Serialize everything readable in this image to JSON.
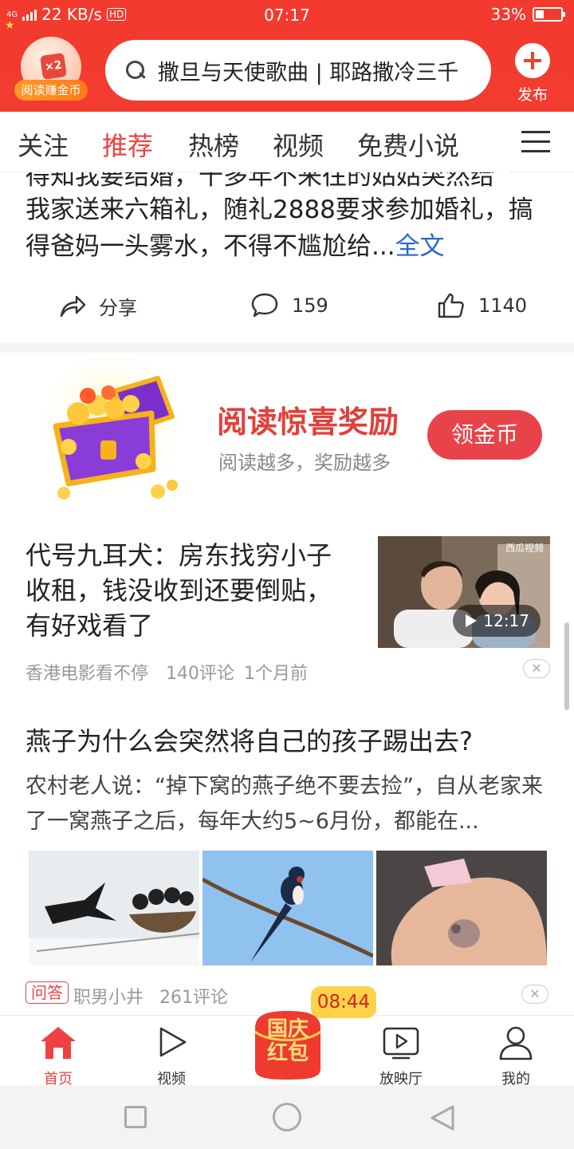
{
  "status_bar": {
    "network": "4G",
    "speed": "22 KB/s",
    "hd": "HD",
    "time": "07:17",
    "battery": "33%",
    "battery_level": 0.33
  },
  "header": {
    "coin_multiplier": "×2",
    "coin_label": "阅读赚金币",
    "search_text": "撒旦与天使歌曲 | 耶路撒冷三千",
    "publish_label": "发布"
  },
  "tabs": [
    "关注",
    "推荐",
    "热榜",
    "视频",
    "免费小说"
  ],
  "active_tab": "推荐",
  "feed": {
    "card1": {
      "cut_line": "得知我要结婚，十多年不来往的姑姑突然给",
      "body": "我家送来六箱礼，随礼2888要求参加婚礼，搞得爸妈一头雾水，不得不尴尬给...",
      "fulltext": "全文",
      "share_label": "分享",
      "comments": "159",
      "likes": "1140"
    },
    "reward": {
      "title": "阅读惊喜奖励",
      "subtitle": "阅读越多，奖励越多",
      "button": "领金币"
    },
    "card3": {
      "title": "代号九耳犬：房东找穷小子收租，钱没收到还要倒贴，有好戏看了",
      "video_source": "西瓜视频",
      "duration": "12:17",
      "source": "香港电影看不停",
      "comments": "140评论",
      "time": "1个月前"
    },
    "card4": {
      "title": "燕子为什么会突然将自己的孩子踢出去?",
      "abstract": "农村老人说：“掉下窝的燕子绝不要去捡”，自从老家来了一窝燕子之后，每年大约5~6月份，都能在...",
      "tag": "问答",
      "source": "职男小井",
      "comments": "261评论"
    }
  },
  "timer": "08:44",
  "bottom_nav": {
    "home": "首页",
    "video": "视频",
    "festival_line1": "国庆",
    "festival_line2": "红包",
    "theater": "放映厅",
    "me": "我的"
  },
  "colors": {
    "brand_red": "#f13c2f",
    "accent_red": "#f04142",
    "link_blue": "#2a66c8",
    "coin_orange": "#ff8a22"
  }
}
